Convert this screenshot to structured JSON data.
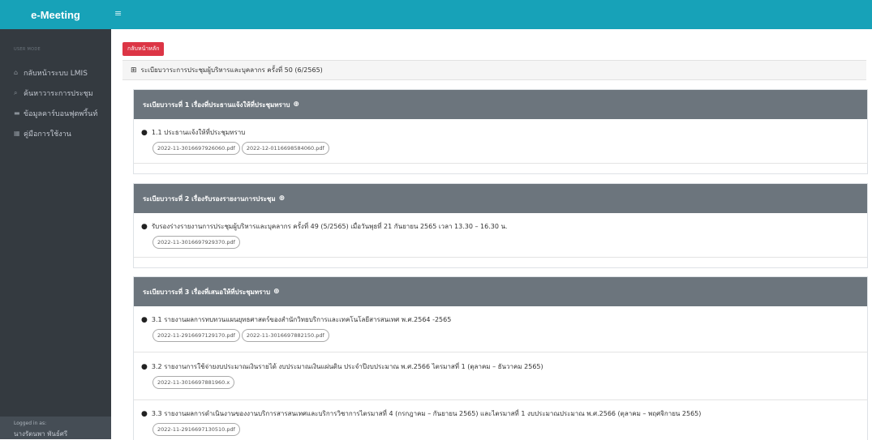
{
  "app": {
    "brand": "e-Meeting"
  },
  "sidebar": {
    "section_label": "USER MODE",
    "items": [
      {
        "icon": "home-icon",
        "glyph": "⌂",
        "label": "กลับหน้าระบบ LMIS"
      },
      {
        "icon": "search-icon",
        "glyph": "⌕",
        "label": "ค้นหาวาระการประชุม"
      },
      {
        "icon": "chart-icon",
        "glyph": "▬",
        "label": "ข้อมูลคาร์บอนฟุตพริ้นท์"
      },
      {
        "icon": "table-icon",
        "glyph": "▦",
        "label": "คู่มือการใช้งาน"
      }
    ],
    "footer": {
      "label": "Logged in as:",
      "user": "นางรัตนพา พันธ์ศรี"
    }
  },
  "main": {
    "back_button": "กลับหน้าหลัก",
    "meeting_title": "ระเบียบวาระการประชุมผู้บริหารและบุคลากร ครั้งที่ 50 (6/2565)",
    "sections": [
      {
        "title": "ระเบียบวาระที่ 1 เรื่องที่ประธานแจ้งให้ที่ประชุมทราบ",
        "items": [
          {
            "title": "1.1 ประธานแจ้งให้ที่ประชุมทราบ",
            "files": [
              "2022-11-3016697926060.pdf",
              "2022-12-0116698584060.pdf"
            ]
          }
        ]
      },
      {
        "title": "ระเบียบวาระที่ 2 เรื่องรับรองรายงานการประชุม",
        "items": [
          {
            "title": "รับรองร่างรายงานการประชุมผู้บริหารและบุคลากร ครั้งที่ 49 (5/2565) เมื่อวันพุธที่ 21 กันยายน 2565 เวลา 13.30 – 16.30 น.",
            "files": [
              "2022-11-3016697929370.pdf"
            ]
          }
        ]
      },
      {
        "title": "ระเบียบวาระที่ 3 เรื่องที่เสนอให้ที่ประชุมทราบ",
        "items": [
          {
            "title": "3.1 รายงานผลการทบทวนแผนยุทธศาสตร์ของสำนักวิทยบริการและเทคโนโลยีสารสนเทศ พ.ศ.2564 -2565",
            "files": [
              "2022-11-2916697129170.pdf",
              "2022-11-3016697882150.pdf"
            ]
          },
          {
            "title": "3.2 รายงานการใช้จ่ายงบประมาณเงินรายได้ งบประมาณเงินแผ่นดิน ประจำปีงบประมาณ พ.ศ.2566 ไตรมาสที่ 1 (ตุลาคม – ธันวาคม 2565)",
            "files": [
              "2022-11-3016697881960.x"
            ]
          },
          {
            "title": "3.3 รายงานผลการดำเนินงานของงานบริการสารสนเทศและบริการวิชาการไตรมาสที่ 4 (กรกฎาคม – กันยายน 2565) และไตรมาสที่ 1 งบประมาณประมาณ พ.ศ.2566 (ตุลาคม – พฤศจิกายน 2565)",
            "files": [
              "2022-11-2916697130510.pdf"
            ]
          }
        ]
      }
    ]
  }
}
